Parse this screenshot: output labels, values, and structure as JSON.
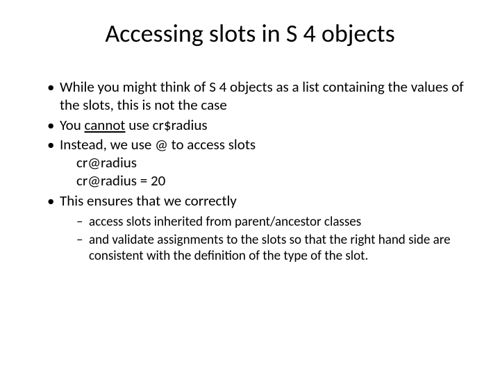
{
  "title": "Accessing slots in S 4 objects",
  "bullets": {
    "b1": "While you might think of S 4 objects as a list containing the values of the slots, this is not the case",
    "b2_pre": "You ",
    "b2_underlined": "cannot",
    "b2_post": " use  cr$radius",
    "b3": "Instead, we use @ to access slots",
    "b3_code1": "cr@radius",
    "b3_code2": "cr@radius = 20",
    "b4": "This ensures that we correctly"
  },
  "sub": {
    "s1": "access slots inherited from parent/ancestor classes",
    "s2": "and validate assignments to the slots so that the right hand side are consistent with the definition of the type of the slot."
  }
}
